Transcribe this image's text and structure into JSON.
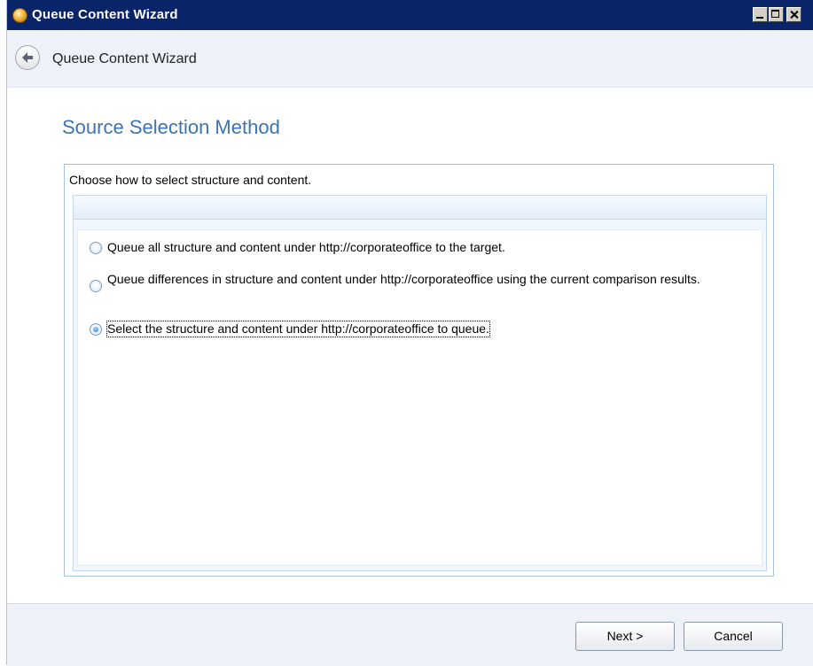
{
  "window": {
    "title": "Queue Content Wizard"
  },
  "header": {
    "title": "Queue Content Wizard"
  },
  "page": {
    "section_title": "Source Selection Method",
    "prompt": "Choose how to select structure and content.",
    "options": [
      {
        "label": "Queue all structure and content under http://corporateoffice to the target.",
        "selected": false
      },
      {
        "label": "Queue differences in structure and content under http://corporateoffice using the current comparison results.",
        "selected": false
      },
      {
        "label": "Select the structure and content under http://corporateoffice to queue.",
        "selected": true
      }
    ]
  },
  "footer": {
    "next_label": "Next >",
    "cancel_label": "Cancel"
  },
  "colors": {
    "titlebar": "#0a246a",
    "section_title": "#3b74b4",
    "panel_border": "#a9c2df"
  }
}
